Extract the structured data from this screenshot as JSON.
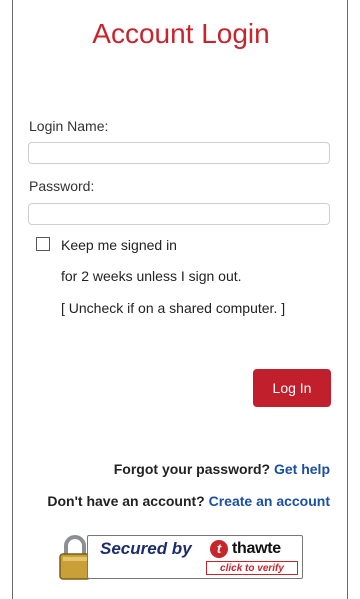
{
  "page": {
    "title": "Account Login"
  },
  "form": {
    "login_name_label": "Login Name:",
    "login_name_value": "",
    "password_label": "Password:",
    "password_value": "",
    "keep_signed_in_label": "Keep me signed in",
    "keep_signed_in_checked": false,
    "keep_signed_in_note_1": "for 2 weeks unless I sign out.",
    "keep_signed_in_note_2": "[ Uncheck if on a shared computer. ]",
    "login_button": "Log In"
  },
  "links": {
    "forgot_prefix": "Forgot your password?",
    "forgot_link": "Get help",
    "signup_prefix": "Don't have an account?",
    "signup_link": "Create an account"
  },
  "seal": {
    "secured_by": "Secured by",
    "brand": "thawte",
    "brand_icon_letter": "t",
    "verify": "click to verify",
    "icon": "padlock-icon"
  },
  "colors": {
    "accent": "#c8242c",
    "link": "#1a4fa3",
    "button": "#c01f2b"
  }
}
